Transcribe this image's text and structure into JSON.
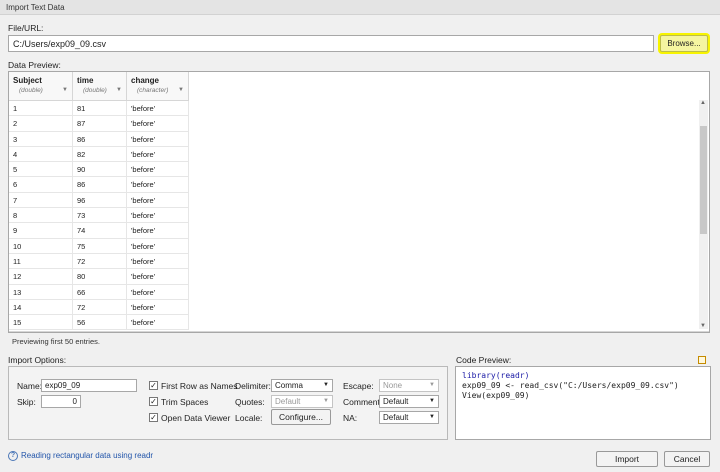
{
  "window": {
    "title": "Import Text Data"
  },
  "file": {
    "label": "File/URL:",
    "value": "C:/Users/exp09_09.csv",
    "browse_label": "Browse..."
  },
  "preview": {
    "label": "Data Preview:",
    "columns": [
      {
        "name": "Subject",
        "type": "(double)"
      },
      {
        "name": "time",
        "type": "(double)"
      },
      {
        "name": "change",
        "type": "(character)"
      }
    ],
    "rows": [
      [
        "1",
        "81",
        "'before'"
      ],
      [
        "2",
        "87",
        "'before'"
      ],
      [
        "3",
        "86",
        "'before'"
      ],
      [
        "4",
        "82",
        "'before'"
      ],
      [
        "5",
        "90",
        "'before'"
      ],
      [
        "6",
        "86",
        "'before'"
      ],
      [
        "7",
        "96",
        "'before'"
      ],
      [
        "8",
        "73",
        "'before'"
      ],
      [
        "9",
        "74",
        "'before'"
      ],
      [
        "10",
        "75",
        "'before'"
      ],
      [
        "11",
        "72",
        "'before'"
      ],
      [
        "12",
        "80",
        "'before'"
      ],
      [
        "13",
        "66",
        "'before'"
      ],
      [
        "14",
        "72",
        "'before'"
      ],
      [
        "15",
        "56",
        "'before'"
      ]
    ],
    "status": "Previewing first 50 entries."
  },
  "options": {
    "label": "Import Options:",
    "name_label": "Name:",
    "name_value": "exp09_09",
    "skip_label": "Skip:",
    "skip_value": "0",
    "first_row_label": "First Row as Names",
    "trim_label": "Trim Spaces",
    "open_viewer_label": "Open Data Viewer",
    "delimiter_label": "Delimiter:",
    "delimiter_value": "Comma",
    "quotes_label": "Quotes:",
    "quotes_value": "Default",
    "locale_label": "Locale:",
    "configure_label": "Configure...",
    "escape_label": "Escape:",
    "escape_value": "None",
    "comment_label": "Comment:",
    "comment_value": "Default",
    "na_label": "NA:",
    "na_value": "Default"
  },
  "code": {
    "label": "Code Preview:",
    "line1": "library(readr)",
    "line2": "exp09_09 <- read_csv(\"C:/Users/exp09_09.csv\")",
    "line3": "View(exp09_09)"
  },
  "footer": {
    "help_text": "Reading rectangular data using readr",
    "import_label": "Import",
    "cancel_label": "Cancel"
  },
  "colors": {
    "browse_highlight": "#f7f400",
    "link": "#2255aa"
  }
}
